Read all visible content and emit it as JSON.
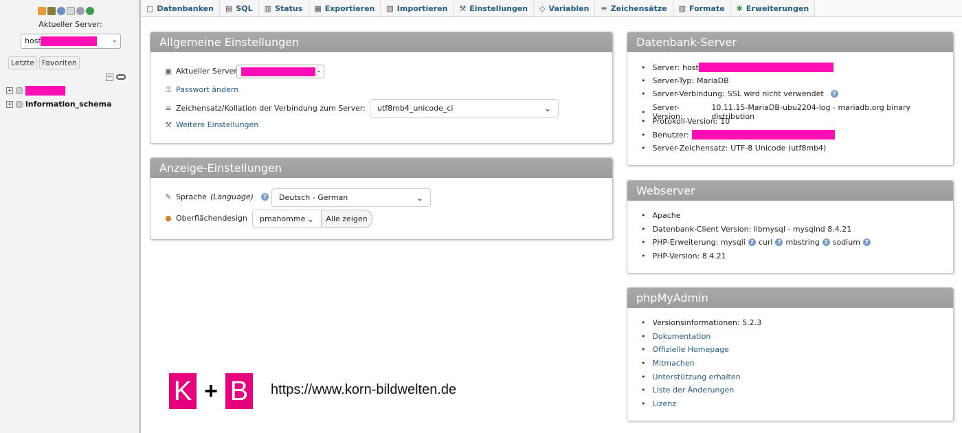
{
  "sidebar": {
    "icons": [
      "home-icon",
      "database-icon",
      "help-icon",
      "document-icon",
      "settings-icon",
      "reload-icon"
    ],
    "server_label": "Aktueller Server:",
    "server_select_value": "host",
    "recent_button": "Letzte",
    "favorites_button": "Favoriten",
    "tree": [
      {
        "name": "",
        "redacted": true
      },
      {
        "name": "information_schema",
        "redacted": false
      }
    ]
  },
  "tabs": [
    {
      "label": "Datenbanken",
      "icon": "database-icon"
    },
    {
      "label": "SQL",
      "icon": "sql-icon"
    },
    {
      "label": "Status",
      "icon": "status-icon"
    },
    {
      "label": "Exportieren",
      "icon": "export-icon"
    },
    {
      "label": "Importieren",
      "icon": "import-icon"
    },
    {
      "label": "Einstellungen",
      "icon": "wrench-icon"
    },
    {
      "label": "Variablen",
      "icon": "variables-icon"
    },
    {
      "label": "Zeichensätze",
      "icon": "charset-icon"
    },
    {
      "label": "Formate",
      "icon": "formats-icon"
    },
    {
      "label": "Erweiterungen",
      "icon": "plugin-icon"
    }
  ],
  "general": {
    "title": "Allgemeine Einstellungen",
    "server_label": "Aktueller Server:",
    "password_link": "Passwort ändern",
    "collation_label": "Zeichensatz/Kollation der Verbindung zum Server:",
    "collation_value": "utf8mb4_unicode_ci",
    "more_settings_link": "Weitere Einstellungen"
  },
  "display": {
    "title": "Anzeige-Einstellungen",
    "language_label": "Sprache",
    "language_label_en": "(Language)",
    "language_value": "Deutsch - German",
    "theme_label": "Oberflächendesign",
    "theme_value": "pmahomme",
    "show_all_button": "Alle zeigen"
  },
  "db_server": {
    "title": "Datenbank-Server",
    "items": [
      {
        "label": "Server:",
        "value": "host",
        "redacted": true
      },
      {
        "label": "Server-Typ:",
        "value": "MariaDB"
      },
      {
        "label": "Server-Verbindung:",
        "value": "SSL wird nicht verwendet",
        "help": true
      },
      {
        "label": "Server-Version:",
        "value": "10.11.15-MariaDB-ubu2204-log - mariadb.org binary distribution"
      },
      {
        "label": "Protokoll-Version:",
        "value": "10"
      },
      {
        "label": "Benutzer:",
        "value": "",
        "redacted": true
      },
      {
        "label": "Server-Zeichensatz:",
        "value": "UTF-8 Unicode (utf8mb4)"
      }
    ]
  },
  "webserver": {
    "title": "Webserver",
    "items": [
      "Apache",
      "Datenbank-Client Version: libmysql - mysqlnd 8.4.21",
      "PHP-Erweiterung: mysqli",
      "PHP-Version: 8.4.21"
    ],
    "php_extensions": [
      "curl",
      "mbstring",
      "sodium"
    ]
  },
  "phpmyadmin": {
    "title": "phpMyAdmin",
    "version": "Versionsinformationen: 5.2.3",
    "links": [
      "Dokumentation",
      "Offizielle Homepage",
      "Mitmachen",
      "Unterstützung erhalten",
      "Liste der Änderungen",
      "Lizenz"
    ]
  },
  "watermark": {
    "logo_k": "K",
    "logo_plus": "+",
    "logo_b": "B",
    "url": "https://www.korn-bildwelten.de"
  }
}
